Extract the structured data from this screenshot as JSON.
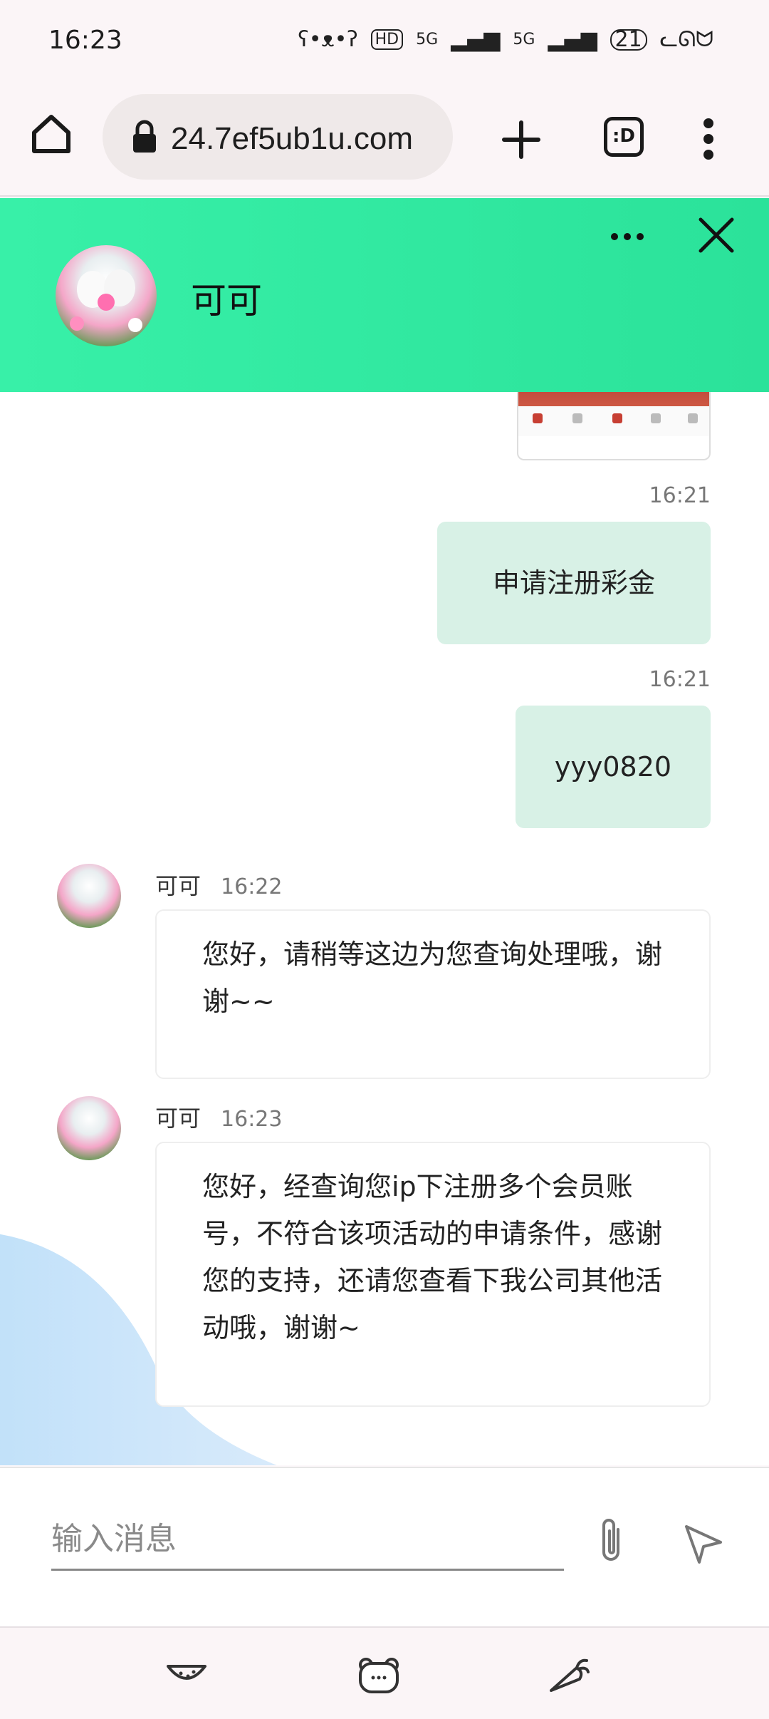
{
  "status_bar": {
    "time": "16:23",
    "badge": "21",
    "net1": "5G",
    "net2": "5G"
  },
  "browser": {
    "url": "24.7ef5ub1u.com",
    "tabs_label": ":D"
  },
  "chat_header": {
    "name": "可可"
  },
  "messages": [
    {
      "dir": "out",
      "time": "16:21",
      "text": "申请注册彩金"
    },
    {
      "dir": "out",
      "time": "16:21",
      "text": "yyy0820"
    },
    {
      "dir": "in",
      "name": "可可",
      "time": "16:22",
      "text": "您好，请稍等这边为您查询处理哦，谢谢~~"
    },
    {
      "dir": "in",
      "name": "可可",
      "time": "16:23",
      "text": "您好，经查询您ip下注册多个会员账号，不符合该项活动的申请条件，感谢您的支持，还请您查看下我公司其他活动哦，谢谢~"
    }
  ],
  "input": {
    "placeholder": "输入消息"
  },
  "colors": {
    "header": "#2be29a",
    "bubble_out": "#d8f1e6"
  }
}
